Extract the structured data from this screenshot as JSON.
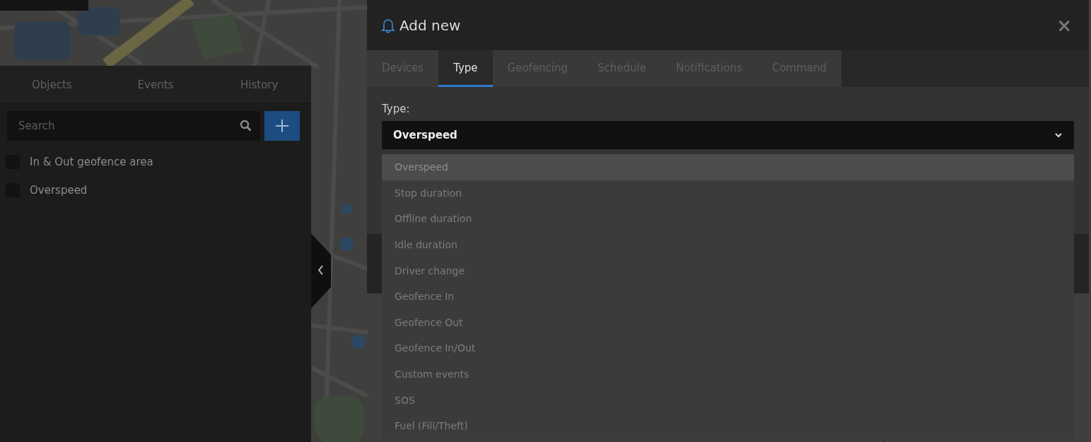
{
  "sidebar": {
    "tabs": [
      {
        "label": "Objects",
        "selected": false
      },
      {
        "label": "Events",
        "selected": false
      },
      {
        "label": "History",
        "selected": false
      }
    ],
    "search": {
      "placeholder": "Search"
    },
    "items": [
      {
        "label": "In & Out geofence area",
        "checked": false
      },
      {
        "label": "Overspeed",
        "checked": false
      }
    ]
  },
  "dialog": {
    "title": "Add new",
    "close": "×",
    "tabs": [
      {
        "label": "Devices",
        "selected": false
      },
      {
        "label": "Type",
        "selected": true
      },
      {
        "label": "Geofencing",
        "selected": false
      },
      {
        "label": "Schedule",
        "selected": false
      },
      {
        "label": "Notifications",
        "selected": false
      },
      {
        "label": "Command",
        "selected": false
      }
    ],
    "field_label": "Type:",
    "select": {
      "value": "Overspeed",
      "expanded": true
    },
    "options": [
      {
        "label": "Overspeed",
        "selected": true
      },
      {
        "label": "Stop duration",
        "selected": false
      },
      {
        "label": "Offline duration",
        "selected": false
      },
      {
        "label": "Idle duration",
        "selected": false
      },
      {
        "label": "Driver change",
        "selected": false
      },
      {
        "label": "Geofence In",
        "selected": false
      },
      {
        "label": "Geofence Out",
        "selected": false
      },
      {
        "label": "Geofence In/Out",
        "selected": false
      },
      {
        "label": "Custom events",
        "selected": false
      },
      {
        "label": "SOS",
        "selected": false
      },
      {
        "label": "Fuel (Fill/Theft)",
        "selected": false
      }
    ]
  }
}
